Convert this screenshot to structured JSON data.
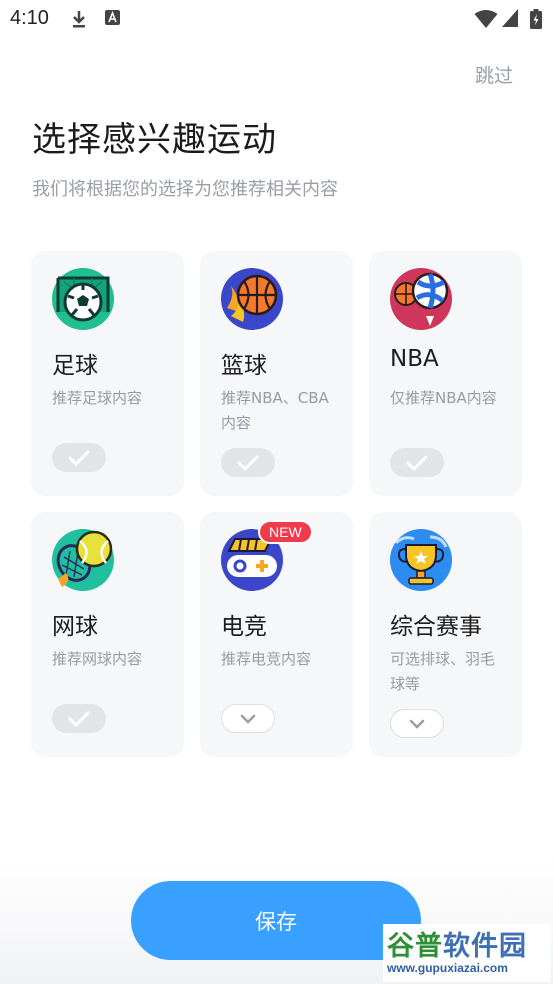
{
  "status_bar": {
    "time": "4:10"
  },
  "header": {
    "skip_label": "跳过",
    "title": "选择感兴趣运动",
    "subtitle": "我们将根据您的选择为您推荐相关内容"
  },
  "sports": [
    {
      "name": "足球",
      "desc": "推荐足球内容",
      "selected": true,
      "icon": "soccer-icon"
    },
    {
      "name": "篮球",
      "desc": "推荐NBA、CBA内容",
      "selected": true,
      "icon": "basketball-icon"
    },
    {
      "name": "NBA",
      "desc": "仅推荐NBA内容",
      "selected": true,
      "icon": "nba-icon"
    },
    {
      "name": "网球",
      "desc": "推荐网球内容",
      "selected": true,
      "icon": "tennis-icon"
    },
    {
      "name": "电竞",
      "desc": "推荐电竞内容",
      "selected": false,
      "icon": "esports-icon",
      "badge": "NEW"
    },
    {
      "name": "综合赛事",
      "desc": "可选排球、羽毛球等",
      "selected": false,
      "icon": "trophy-icon"
    }
  ],
  "footer": {
    "save_label": "保存"
  },
  "watermark": {
    "main_a": "谷普",
    "main_b": "软件园",
    "url": "www.gupuxiazai.com"
  },
  "colors": {
    "accent": "#3aa0ff",
    "badge": "#f23a4d"
  }
}
